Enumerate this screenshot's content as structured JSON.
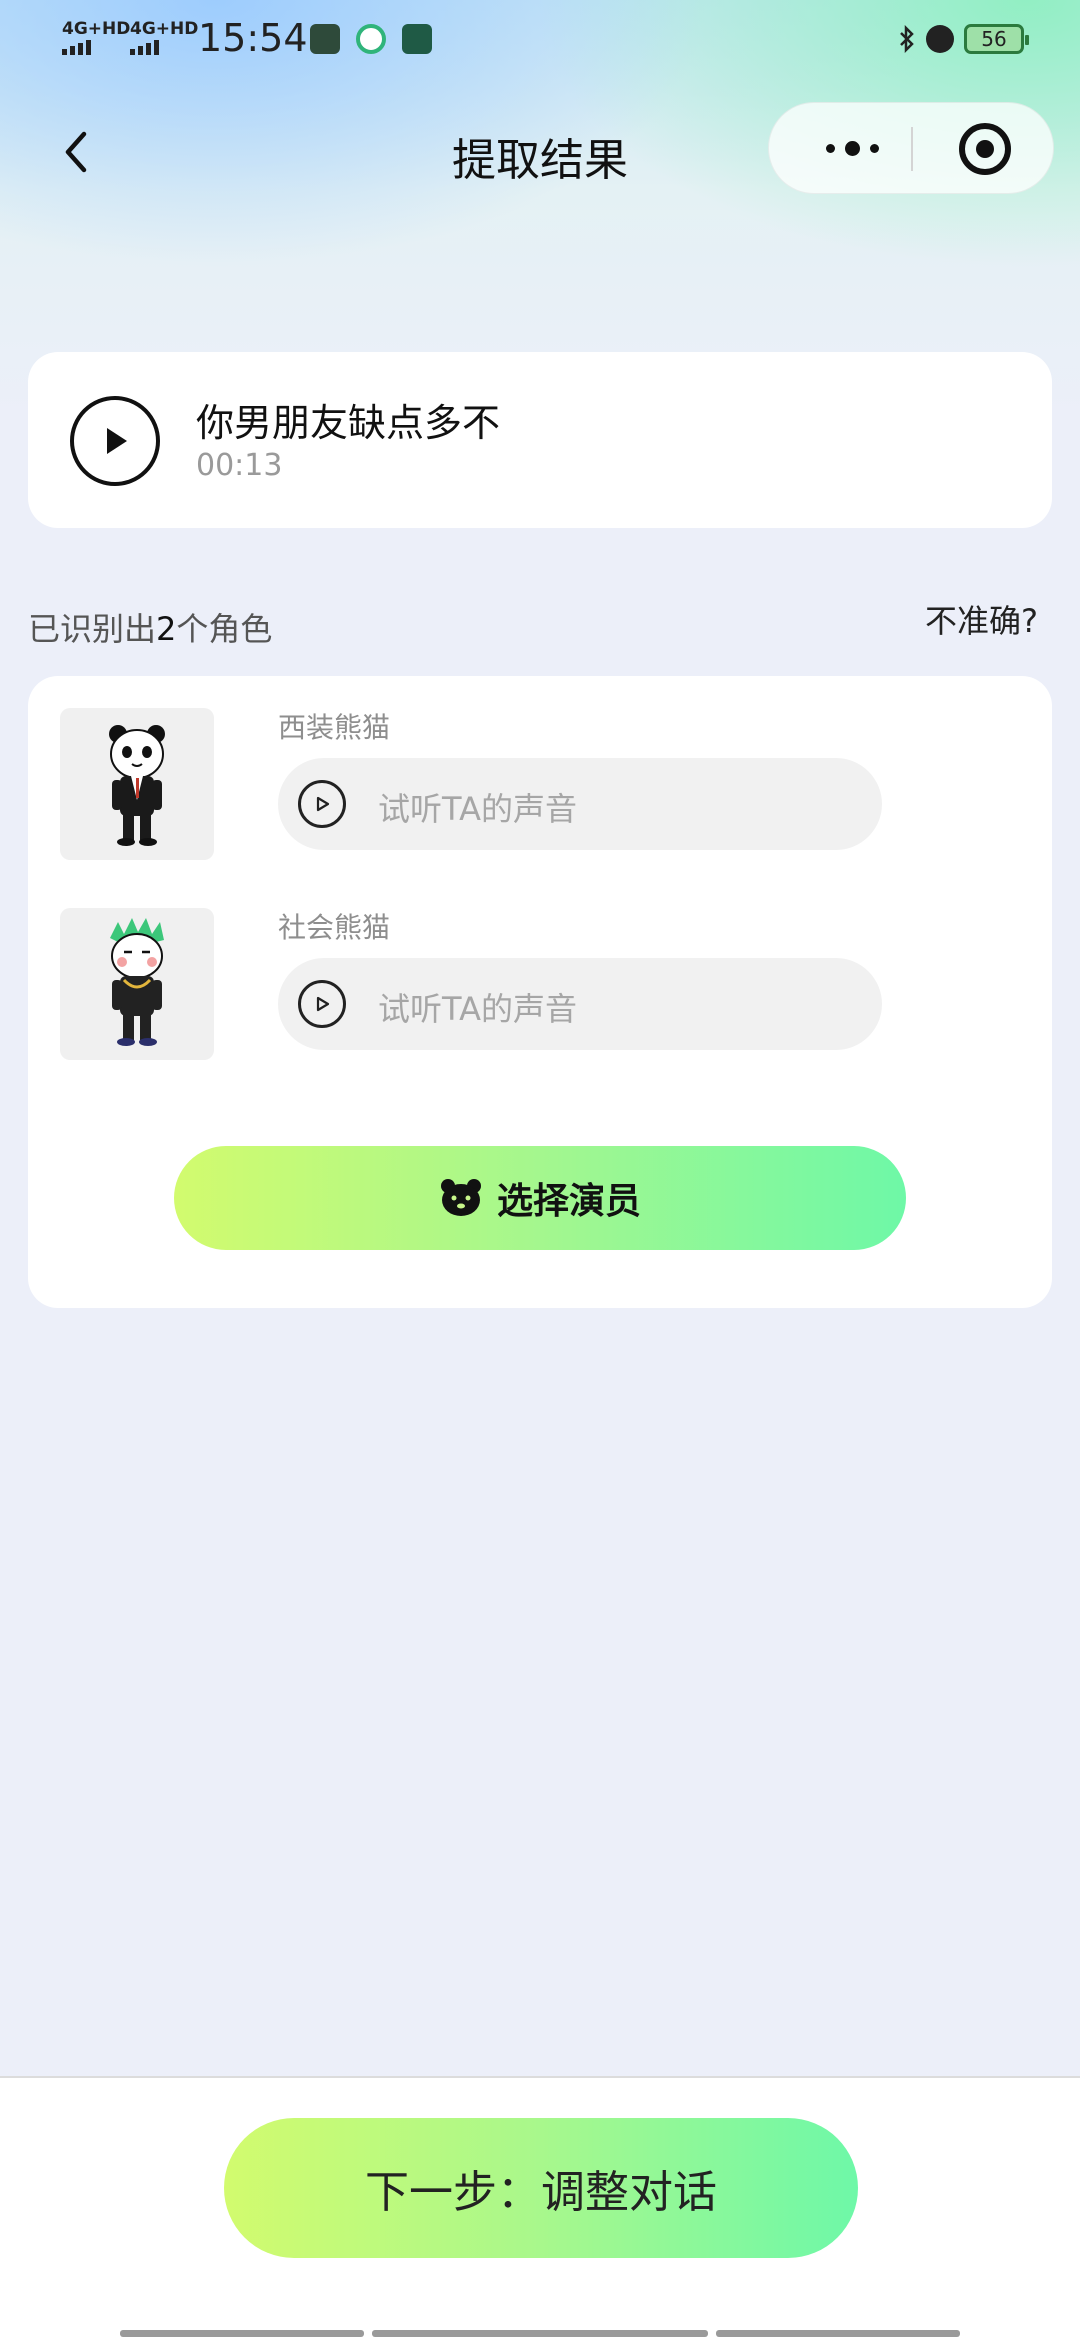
{
  "status_bar": {
    "signal_1": "4G+HD",
    "signal_2": "4G+HD",
    "time": "15:54",
    "battery": "56"
  },
  "nav": {
    "title": "提取结果"
  },
  "audio": {
    "title": "你男朋友缺点多不",
    "duration": "00:13"
  },
  "roles_header": {
    "prefix": "已识别出",
    "count": "2",
    "suffix": "个角色",
    "inaccurate_link": "不准确?"
  },
  "roles": [
    {
      "name": "西装熊猫",
      "listen_label": "试听TA的声音"
    },
    {
      "name": "社会熊猫",
      "listen_label": "试听TA的声音"
    }
  ],
  "choose_actor_label": "选择演员",
  "next_button_label": "下一步：调整对话",
  "colors": {
    "accent_start": "#d2fb6e",
    "accent_end": "#6ef8a7",
    "background": "#eceff9"
  }
}
